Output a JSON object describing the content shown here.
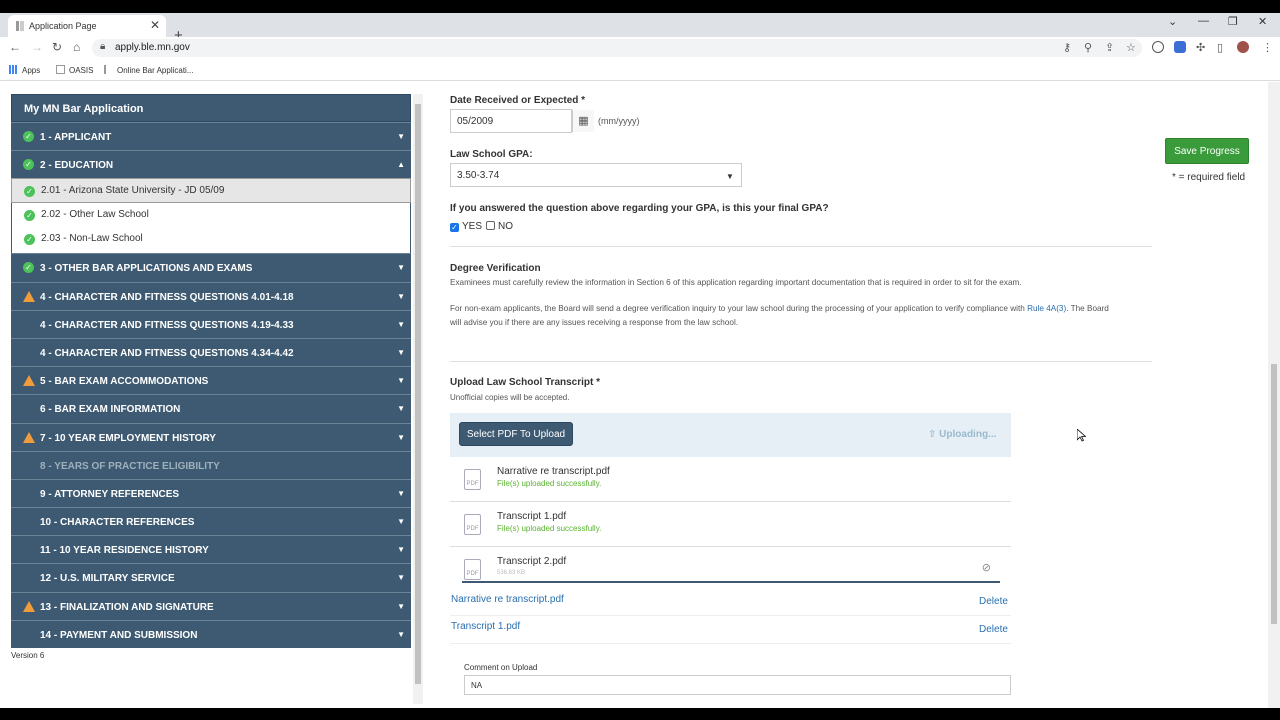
{
  "browser": {
    "tab_title": "Application Page",
    "tab_close": "✕",
    "new_tab": "+",
    "url": "apply.ble.mn.gov",
    "bookmarks": [
      "Apps",
      "OASIS",
      "Online Bar Applicati..."
    ]
  },
  "sidebar": {
    "title": "My MN Bar Application",
    "sections": [
      {
        "label": "1 - APPLICANT",
        "status": "ok"
      },
      {
        "label": "2 - EDUCATION",
        "status": "ok",
        "expanded": true
      },
      {
        "label": "3 - OTHER BAR APPLICATIONS AND EXAMS",
        "status": "ok"
      },
      {
        "label": "4 - CHARACTER AND FITNESS QUESTIONS 4.01-4.18",
        "status": "warn"
      },
      {
        "label": "4 - CHARACTER AND FITNESS QUESTIONS 4.19-4.33",
        "status": "none"
      },
      {
        "label": "4 - CHARACTER AND FITNESS QUESTIONS 4.34-4.42",
        "status": "none"
      },
      {
        "label": "5 - BAR EXAM ACCOMMODATIONS",
        "status": "warn"
      },
      {
        "label": "6 - BAR EXAM INFORMATION",
        "status": "none"
      },
      {
        "label": "7 - 10 YEAR EMPLOYMENT HISTORY",
        "status": "warn"
      },
      {
        "label": "8 - YEARS OF PRACTICE ELIGIBILITY",
        "status": "disabled"
      },
      {
        "label": "9 - ATTORNEY REFERENCES",
        "status": "none"
      },
      {
        "label": "10 - CHARACTER REFERENCES",
        "status": "none"
      },
      {
        "label": "11 - 10 YEAR RESIDENCE HISTORY",
        "status": "none"
      },
      {
        "label": "12 - U.S. MILITARY SERVICE",
        "status": "none"
      },
      {
        "label": "13 - FINALIZATION AND SIGNATURE",
        "status": "warn"
      },
      {
        "label": "14 - PAYMENT AND SUBMISSION",
        "status": "none"
      }
    ],
    "education_subitems": [
      "2.01 - Arizona State University - JD 05/09",
      "2.02 - Other Law School",
      "2.03 - Non-Law School"
    ],
    "version": "Version 6"
  },
  "form": {
    "date_label": "Date Received or Expected *",
    "date_value": "05/2009",
    "date_hint": "(mm/yyyy)",
    "gpa_label": "Law School GPA:",
    "gpa_value": "3.50-3.74",
    "final_gpa_question": "If you answered the question above regarding your GPA, is this your final GPA?",
    "yes_label": "YES",
    "no_label": "NO",
    "degree_title": "Degree Verification",
    "degree_p1": "Examinees must carefully review the information in Section 6 of this application regarding important documentation that is required in order to sit for the exam.",
    "degree_p2a": "For non-exam applicants, the Board will send a degree verification inquiry to your law school during the processing of your application to verify compliance with ",
    "degree_p2_link": "Rule 4A(3)",
    "degree_p2b": ". The Board",
    "degree_p2c": "will advise you if there are any issues receiving a response from the law school.",
    "upload_title": "Upload Law School Transcript *",
    "upload_note": "Unofficial copies will be accepted.",
    "select_button": "Select PDF To Upload",
    "uploading": "Uploading...",
    "files": [
      {
        "name": "Narrative re transcript.pdf",
        "status": "File(s) uploaded successfully."
      },
      {
        "name": "Transcript 1.pdf",
        "status": "File(s) uploaded successfully."
      },
      {
        "name": "Transcript 2.pdf",
        "status": "536.63 KB"
      }
    ],
    "uploaded_links": [
      "Narrative re transcript.pdf",
      "Transcript 1.pdf"
    ],
    "delete_label": "Delete",
    "comment_label": "Comment on Upload",
    "comment_value": "NA",
    "save_button": "Save Progress",
    "required_note": "* = required field"
  }
}
